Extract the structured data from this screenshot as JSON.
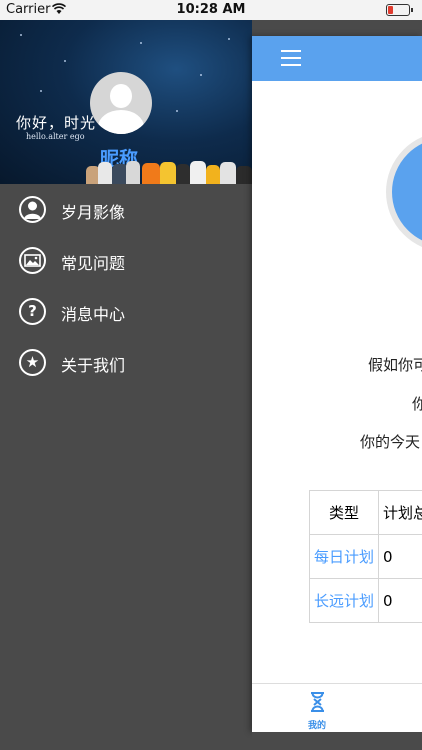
{
  "status_bar": {
    "carrier": "Carrier",
    "time": "10:28 AM"
  },
  "drawer": {
    "header": {
      "greeting": "你好，时光",
      "greeting_sub": "hello.alter ego",
      "nickname": "昵称"
    },
    "items": [
      {
        "icon": "person-icon",
        "label": "岁月影像"
      },
      {
        "icon": "image-icon",
        "label": "常见问题"
      },
      {
        "icon": "question-icon",
        "label": "消息中心"
      },
      {
        "icon": "star-icon",
        "label": "关于我们"
      }
    ]
  },
  "main": {
    "texts": [
      "假如你可",
      "你",
      "你的今天"
    ],
    "table": {
      "headers": [
        "类型",
        "计划总"
      ],
      "rows": [
        {
          "type": "每日计划",
          "value": "0"
        },
        {
          "type": "长远计划",
          "value": "0"
        }
      ]
    },
    "tabbar": {
      "active_label": "我的"
    }
  },
  "colors": {
    "accent": "#5aa2ee",
    "link": "#4a9cff",
    "drawer_bg": "#4a4a4a"
  }
}
